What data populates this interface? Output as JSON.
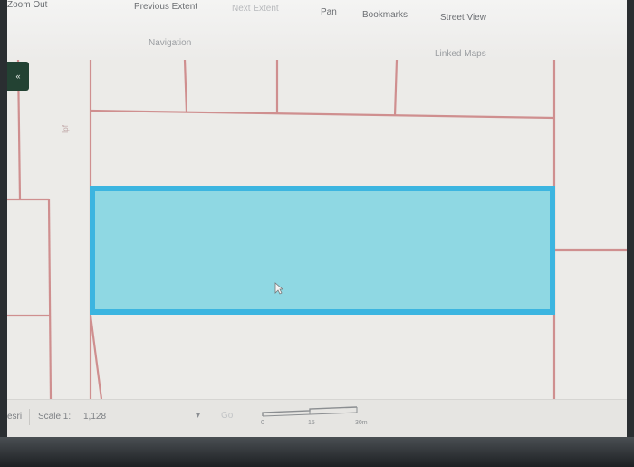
{
  "ribbon": {
    "zoom_out": "Zoom Out",
    "previous_extent": "Previous Extent",
    "next_extent": "Next Extent",
    "pan": "Pan",
    "bookmarks": "Bookmarks",
    "street_view": "Street View",
    "group_navigation": "Navigation",
    "group_linked_maps": "Linked Maps"
  },
  "map": {
    "side_label": "Ipf",
    "right_label": "",
    "collapse_tab": "«",
    "selection_color": "#8fd8e3",
    "selection_border": "#3cb5e0",
    "parcel_line_color": "#cf8f8f"
  },
  "statusbar": {
    "coord_sys": "esri",
    "scale_label": "Scale 1:",
    "scale_value": "1,128",
    "scale_arrow": "▾",
    "scale_go": "Go",
    "scalebar_ticks": [
      "0",
      "15",
      "30m"
    ]
  },
  "icons": {
    "cursor": "mouse-pointer-icon",
    "collapse": "collapse-panel-icon"
  }
}
